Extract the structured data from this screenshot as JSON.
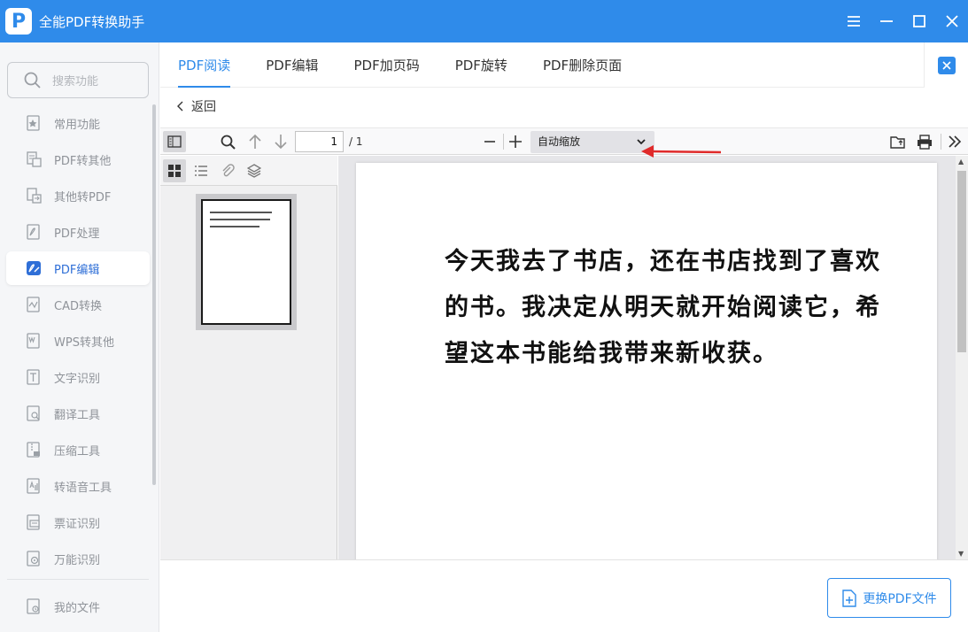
{
  "app": {
    "title": "全能PDF转换助手",
    "logo_letter": "P"
  },
  "colors": {
    "accent": "#2f8bea",
    "annotation": "#e02a2a"
  },
  "sidebar": {
    "search_placeholder": "搜索功能",
    "items": [
      {
        "label": "常用功能",
        "icon": "star-doc-icon"
      },
      {
        "label": "PDF转其他",
        "icon": "pdf-export-icon"
      },
      {
        "label": "其他转PDF",
        "icon": "pdf-import-icon"
      },
      {
        "label": "PDF处理",
        "icon": "pdf-process-icon"
      },
      {
        "label": "PDF编辑",
        "icon": "pdf-edit-icon",
        "active": true
      },
      {
        "label": "CAD转换",
        "icon": "cad-icon"
      },
      {
        "label": "WPS转其他",
        "icon": "wps-icon"
      },
      {
        "label": "文字识别",
        "icon": "ocr-icon"
      },
      {
        "label": "翻译工具",
        "icon": "translate-icon"
      },
      {
        "label": "压缩工具",
        "icon": "zip-icon"
      },
      {
        "label": "转语音工具",
        "icon": "voice-icon"
      },
      {
        "label": "票证识别",
        "icon": "ticket-icon"
      },
      {
        "label": "万能识别",
        "icon": "scan-icon"
      }
    ],
    "footer_item": {
      "label": "我的文件",
      "icon": "my-files-icon"
    }
  },
  "tabs": [
    "PDF阅读",
    "PDF编辑",
    "PDF加页码",
    "PDF旋转",
    "PDF删除页面"
  ],
  "active_tab": "PDF阅读",
  "back_label": "返回",
  "viewer": {
    "page_number": "1",
    "page_count": "/ 1",
    "zoom": "自动缩放",
    "page_text": "今天我去了书店，还在书店找到了喜欢的书。我决定从明天就开始阅读它，希望这本书能给我带来新收获。"
  },
  "replace_button": "更换PDF文件"
}
